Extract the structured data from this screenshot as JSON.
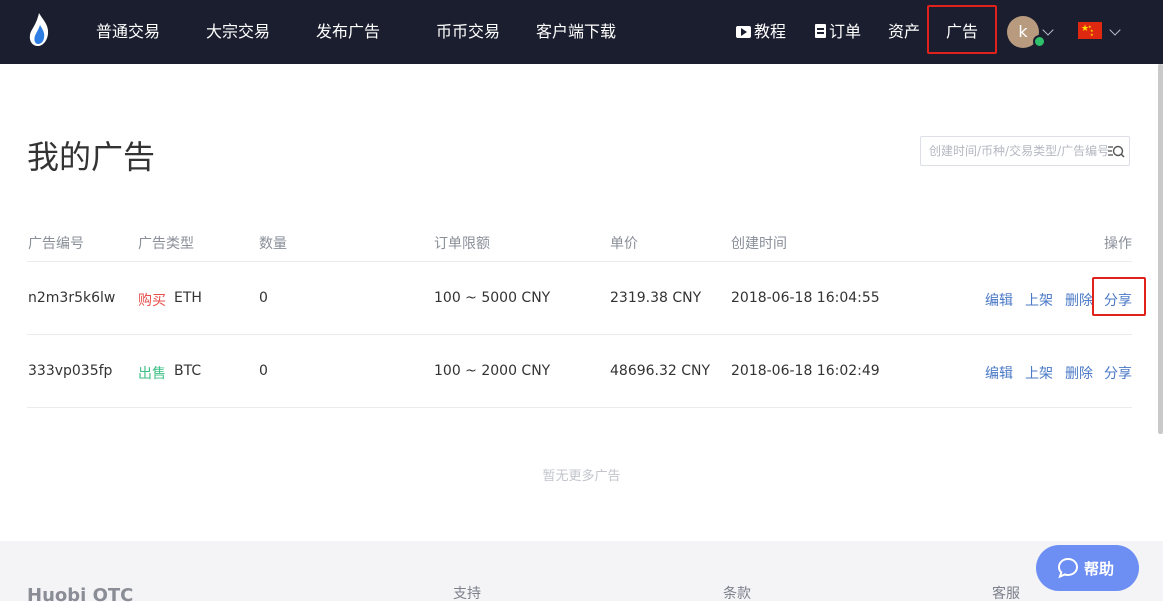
{
  "nav": {
    "items": [
      "普通交易",
      "大宗交易",
      "发布广告",
      "币币交易",
      "客户端下载"
    ],
    "tutorial": "教程",
    "orders": "订单",
    "assets": "资产",
    "ads": "广告",
    "avatar_letter": "k"
  },
  "page": {
    "title": "我的广告",
    "search_placeholder": "创建时间/币种/交易类型/广告编号"
  },
  "table": {
    "headers": [
      "广告编号",
      "广告类型",
      "数量",
      "订单限额",
      "单价",
      "创建时间",
      "操作"
    ],
    "rows": [
      {
        "id": "n2m3r5k6lw",
        "type": "购买",
        "coin": "ETH",
        "quantity": "0",
        "limit": "100 ~ 5000 CNY",
        "price": "2319.38 CNY",
        "created": "2018-06-18 16:04:55",
        "actions": [
          "编辑",
          "上架",
          "删除",
          "分享"
        ]
      },
      {
        "id": "333vp035fp",
        "type": "出售",
        "coin": "BTC",
        "quantity": "0",
        "limit": "100 ~ 2000 CNY",
        "price": "48696.32 CNY",
        "created": "2018-06-18 16:02:49",
        "actions": [
          "编辑",
          "上架",
          "删除",
          "分享"
        ]
      }
    ],
    "empty_note": "暂无更多广告"
  },
  "footer": {
    "brand": "Huobi OTC",
    "cols": [
      "支持",
      "条款",
      "客服"
    ]
  },
  "help": {
    "label": "帮助"
  },
  "colors": {
    "nav_bg": "#1b1e2e",
    "highlight": "#e0211c",
    "buy": "#e5504b",
    "sell": "#3ebf86",
    "link": "#4a79c6",
    "help_bg": "#6d8ff4"
  }
}
